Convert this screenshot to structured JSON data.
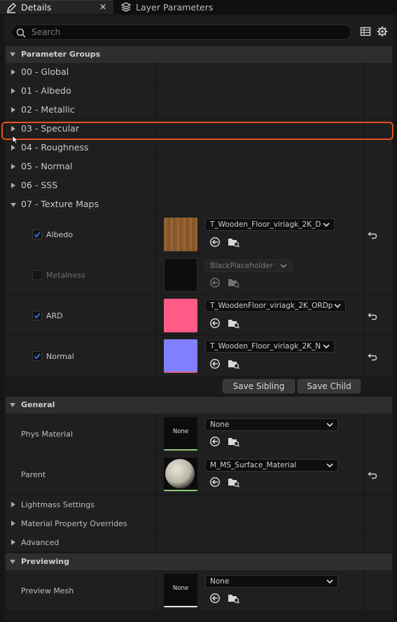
{
  "tabs": [
    {
      "label": "Details",
      "active": true,
      "icon": "pencil-icon"
    },
    {
      "label": "Layer Parameters",
      "active": false,
      "icon": "layers-icon"
    }
  ],
  "search": {
    "placeholder": "Search"
  },
  "sections": {
    "parameter_groups": "Parameter Groups",
    "general": "General",
    "previewing": "Previewing"
  },
  "groups": [
    "00 - Global",
    "01 - Albedo",
    "02 - Metallic",
    "03 - Specular",
    "04 - Roughness",
    "05 - Normal",
    "06 - SSS",
    "07 - Texture Maps"
  ],
  "texture_maps": [
    {
      "name": "Albedo",
      "checked": true,
      "enabled": true,
      "texture": "T_Wooden_Floor_viriagk_2K_D",
      "swatch": "#8b5a2b"
    },
    {
      "name": "Metalness",
      "checked": false,
      "enabled": false,
      "texture": "BlackPlaceholder",
      "swatch": "#0d0d0d"
    },
    {
      "name": "ARD",
      "checked": true,
      "enabled": true,
      "texture": "T_WoodenFloor_viriagk_2K_ORDp",
      "swatch": "#ff5b86"
    },
    {
      "name": "Normal",
      "checked": true,
      "enabled": true,
      "texture": "T_Wooden_Floor_viriagk_2K_N",
      "swatch": "#8080ff"
    }
  ],
  "buttons": {
    "save_sibling": "Save Sibling",
    "save_child": "Save Child"
  },
  "general": {
    "phys_material": {
      "label": "Phys Material",
      "thumb": "None",
      "value": "None"
    },
    "parent": {
      "label": "Parent",
      "value": "M_MS_Surface_Material"
    },
    "collapsed": [
      "Lightmass Settings",
      "Material Property Overrides",
      "Advanced"
    ]
  },
  "previewing": {
    "preview_mesh": {
      "label": "Preview Mesh",
      "thumb": "None",
      "value": "None"
    }
  },
  "colors": {
    "highlight": "#e0531f",
    "accent_check": "#2f6fd8"
  }
}
